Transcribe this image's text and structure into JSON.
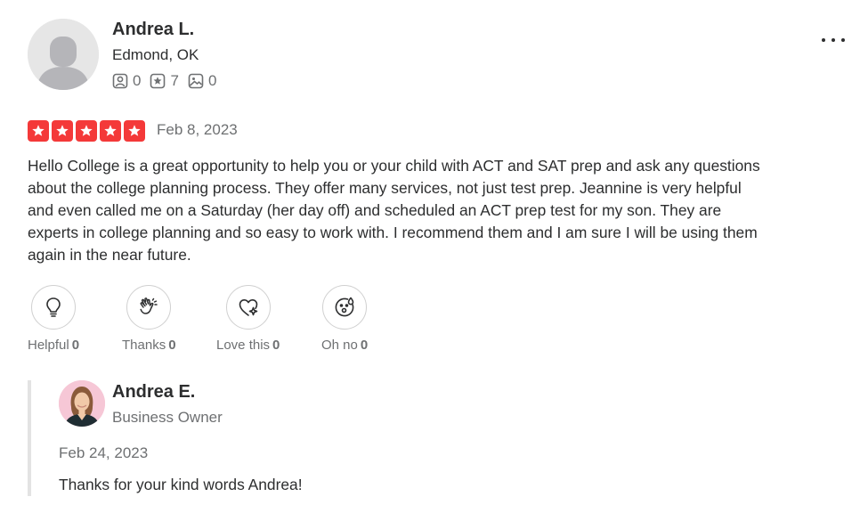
{
  "reviewer": {
    "name": "Andrea L.",
    "location": "Edmond, OK",
    "stats": {
      "friends": "0",
      "reviews": "7",
      "photos": "0"
    }
  },
  "review": {
    "rating": 5,
    "date": "Feb 8, 2023",
    "text": "Hello College is a great opportunity to help you or your child with ACT and SAT prep and ask any questions about the college planning process. They offer many services, not just test prep. Jeannine is very helpful and even called me on a Saturday (her day off) and scheduled an ACT prep test for my son. They are experts in college planning and so easy to work with. I recommend them and I am sure I will be using them again in the near future."
  },
  "reactions": [
    {
      "label": "Helpful",
      "count": "0",
      "icon": "lightbulb-icon"
    },
    {
      "label": "Thanks",
      "count": "0",
      "icon": "clapping-hands-icon"
    },
    {
      "label": "Love this",
      "count": "0",
      "icon": "heart-sparkle-icon"
    },
    {
      "label": "Oh no",
      "count": "0",
      "icon": "surprised-face-icon"
    }
  ],
  "owner_reply": {
    "name": "Andrea E.",
    "role": "Business Owner",
    "date": "Feb 24, 2023",
    "text": "Thanks for your kind words Andrea!"
  },
  "colors": {
    "star_red": "#f43939",
    "text": "#2d2e2f",
    "muted": "#6e7072",
    "border": "#e3e3e3"
  }
}
